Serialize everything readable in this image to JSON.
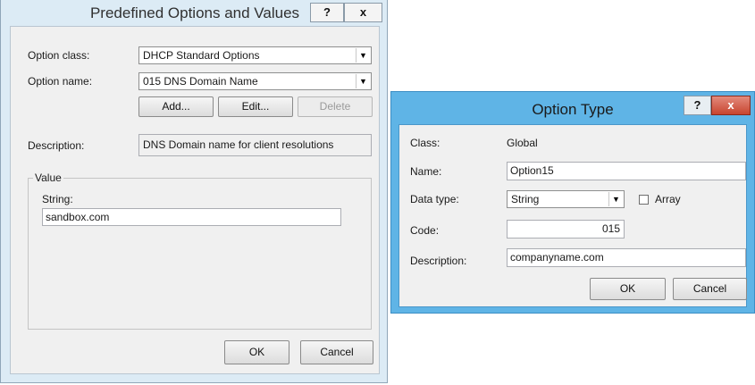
{
  "dialog1": {
    "title": "Predefined Options and Values",
    "help_label": "?",
    "close_label": "x",
    "option_class_label": "Option class:",
    "option_class_value": "DHCP Standard Options",
    "option_name_label": "Option name:",
    "option_name_value": "015 DNS Domain Name",
    "add_label": "Add...",
    "edit_label": "Edit...",
    "delete_label": "Delete",
    "description_label": "Description:",
    "description_value": "DNS Domain name for client resolutions",
    "value_group_label": "Value",
    "string_label": "String:",
    "string_value": "sandbox.com",
    "ok_label": "OK",
    "cancel_label": "Cancel"
  },
  "dialog2": {
    "title": "Option Type",
    "help_label": "?",
    "close_label": "x",
    "class_label": "Class:",
    "class_value": "Global",
    "name_label": "Name:",
    "name_value": "Option15",
    "data_type_label": "Data type:",
    "data_type_value": "String",
    "array_label": "Array",
    "array_checked": false,
    "code_label": "Code:",
    "code_value": "015",
    "description_label": "Description:",
    "description_value": "companyname.com",
    "ok_label": "OK",
    "cancel_label": "Cancel"
  },
  "icons": {
    "dropdown_arrow": "▼"
  },
  "colors": {
    "dialog1_frame": "#dcebf5",
    "dialog2_frame": "#5fb4e6",
    "close_button_red": "#c8452f"
  }
}
